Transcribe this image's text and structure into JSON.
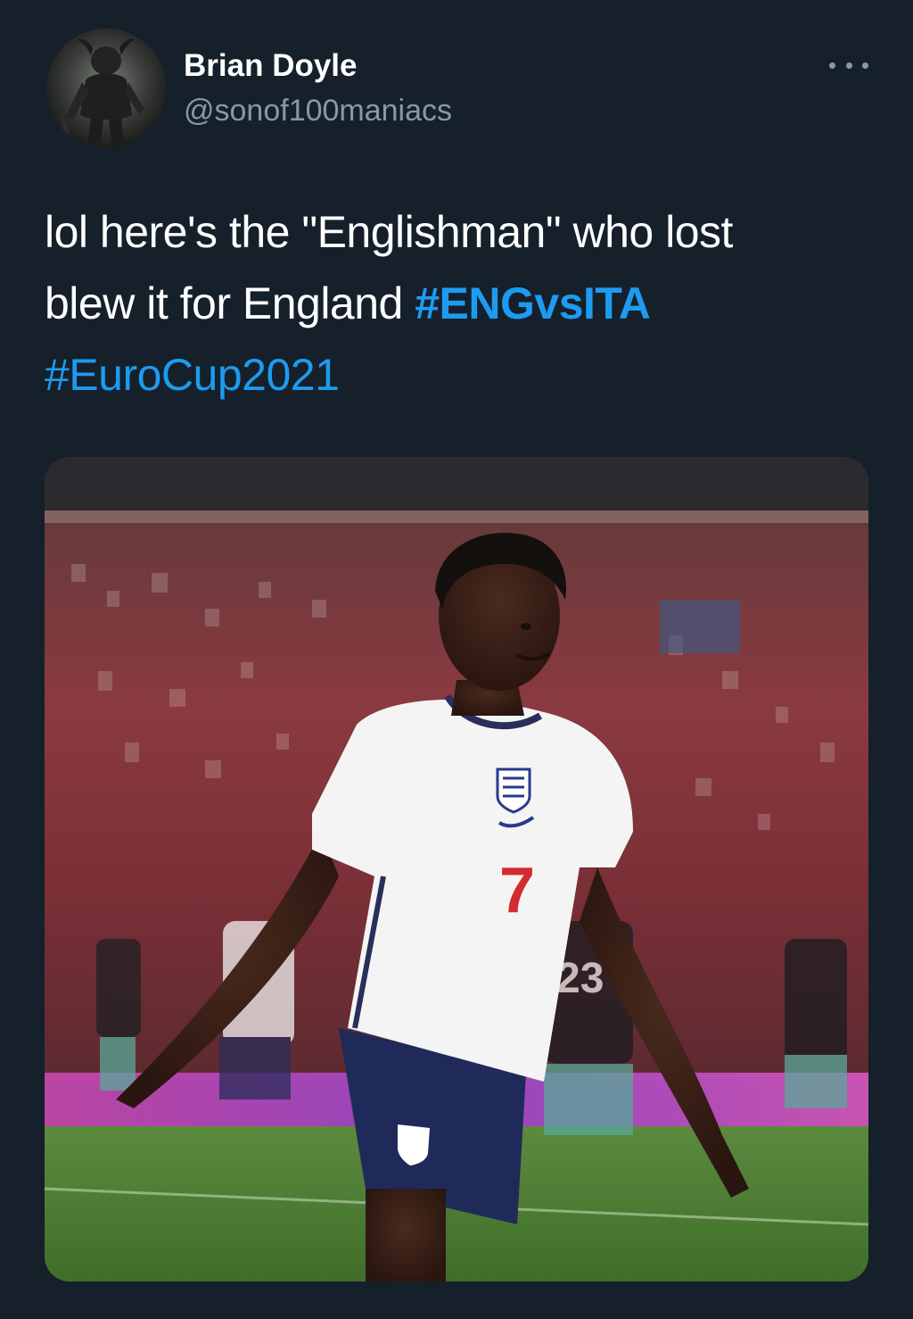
{
  "tweet": {
    "author": {
      "display_name": "Brian Doyle",
      "handle": "@sonof100maniacs",
      "avatar_icon": "avatar-image"
    },
    "more_icon": "more-dots-icon",
    "text": {
      "line_1": "lol here's the \"Englishman\" who lost",
      "line_2_text": "blew it for England ",
      "hashtag_1": "#ENGvsITA",
      "hashtag_2": "#EuroCup2021"
    },
    "media": {
      "kind": "photo",
      "shirt_number": "7",
      "background_player_number": "23"
    },
    "colors": {
      "background": "#15202b",
      "text": "#ffffff",
      "secondary": "#8899a6",
      "link": "#1d9bf0"
    }
  }
}
